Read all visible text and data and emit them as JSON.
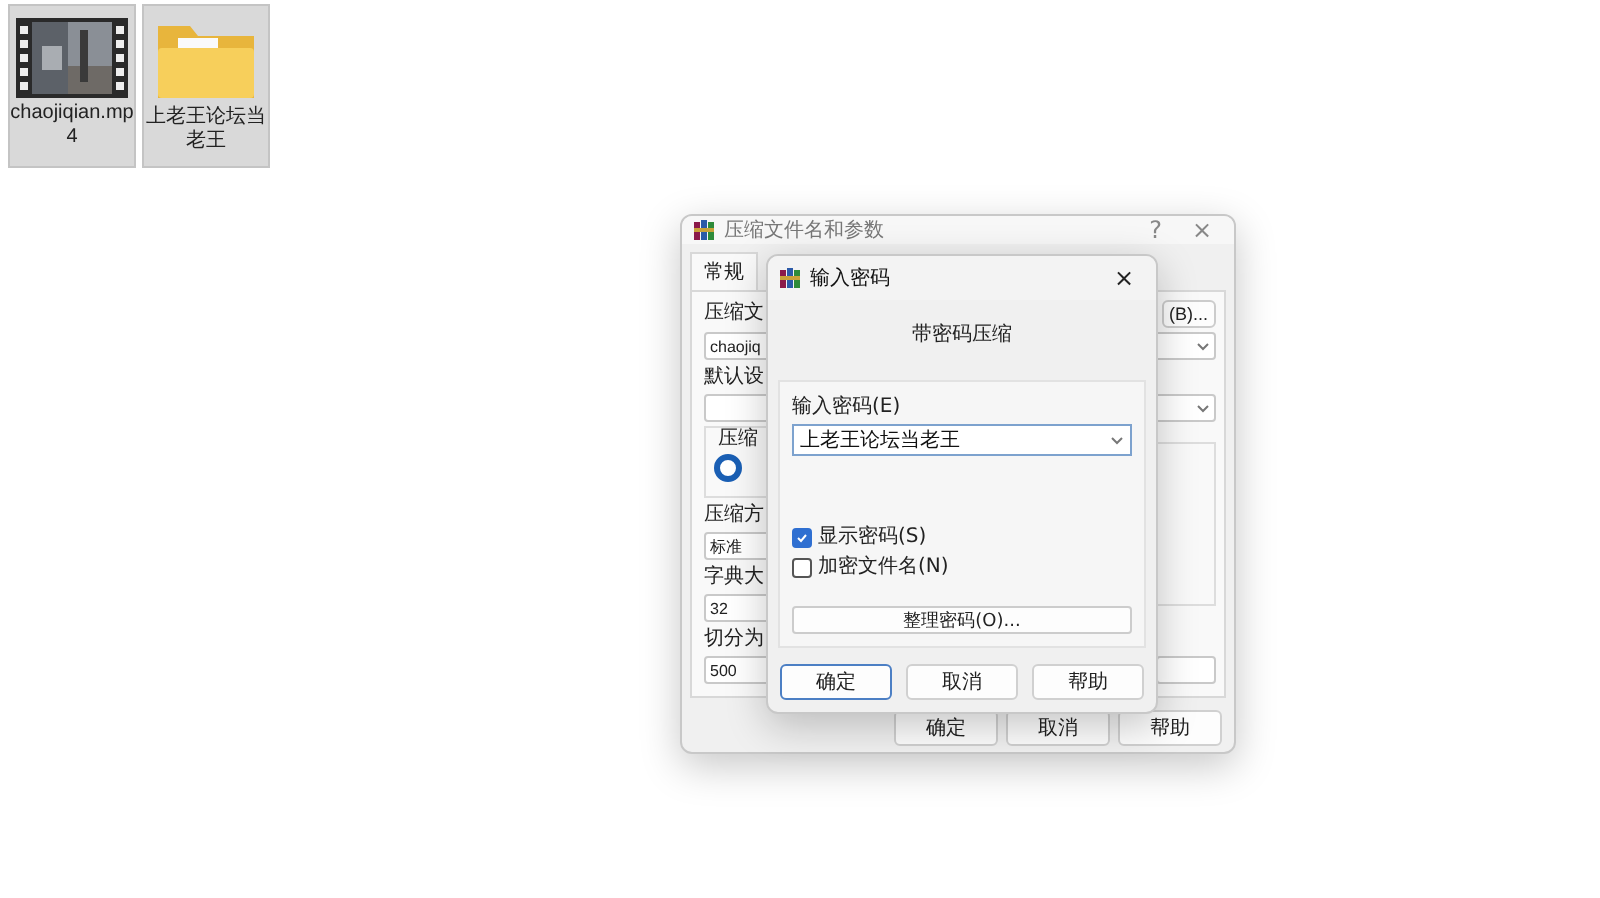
{
  "desktop_icons": [
    {
      "kind": "video",
      "label": "chaojiqian.mp4",
      "selected": true
    },
    {
      "kind": "folder",
      "label": "上老王论坛当老王",
      "selected": true
    }
  ],
  "back_dialog": {
    "title": "压缩文件名和参数",
    "help": "?",
    "close": "×",
    "tabs": [
      {
        "label": "常规",
        "selected": true
      }
    ],
    "archive_name_label": "压缩文",
    "browse_button": "(B)...",
    "archive_name": "chaojiq",
    "profile_label": "默认设",
    "group_label": "压缩",
    "radio": {
      "selected": true
    },
    "method_label": "压缩方",
    "method": "标准",
    "dict_label": "字典大",
    "dict": "32",
    "split_label": "切分为",
    "split": "500",
    "buttons": [
      {
        "label": "确定"
      },
      {
        "label": "取消"
      },
      {
        "label": "帮助"
      }
    ]
  },
  "password_dialog": {
    "title": "输入密码",
    "close": "×",
    "heading": "带密码压缩",
    "password_label": "输入密码(E)",
    "password": "上老王论坛当老王",
    "checkboxes": [
      {
        "label": "显示密码(S)",
        "checked": true
      },
      {
        "label": "加密文件名(N)",
        "checked": false
      }
    ],
    "organize_button": "整理密码(O)...",
    "buttons": [
      {
        "label": "确定",
        "selected": true
      },
      {
        "label": "取消",
        "selected": false
      },
      {
        "label": "帮助",
        "selected": false
      }
    ]
  }
}
